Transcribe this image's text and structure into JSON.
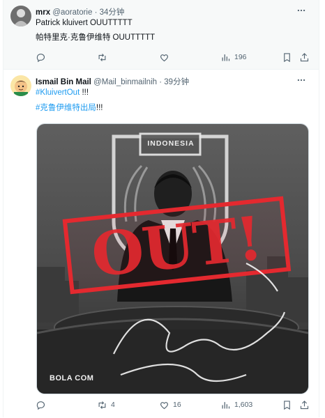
{
  "tweets": [
    {
      "display_name": "mrx",
      "handle": "@aoratorie",
      "time": "34分钟",
      "lines": [
        "Patrick kluivert OUUTTTTT",
        "帕特里克·克鲁伊维特 OUUTTTTT"
      ],
      "stats": {
        "replies": "",
        "retweets": "",
        "likes": "",
        "views": "196"
      }
    },
    {
      "display_name": "Ismail Bin Mail",
      "handle": "@Mail_binmailnih",
      "time": "39分钟",
      "hashtag1": "#KluivertOut",
      "hashtag1_suffix": "!!!",
      "hashtag2": "#克鲁伊维特出局",
      "hashtag2_suffix": "!!!",
      "image": {
        "crest_label": "INDONESIA",
        "stamp_text": "OUT!",
        "watermark": "BOLA COM",
        "signature_text": "Patrick Kluivert"
      },
      "stats": {
        "replies": "",
        "retweets": "4",
        "likes": "16",
        "views": "1,603"
      }
    }
  ],
  "colors": {
    "accent": "#1d9bf0",
    "muted": "#536471",
    "stamp": "#e4292f"
  },
  "icons": [
    "more-icon",
    "reply-icon",
    "retweet-icon",
    "like-icon",
    "views-icon",
    "bookmark-icon",
    "share-icon"
  ]
}
